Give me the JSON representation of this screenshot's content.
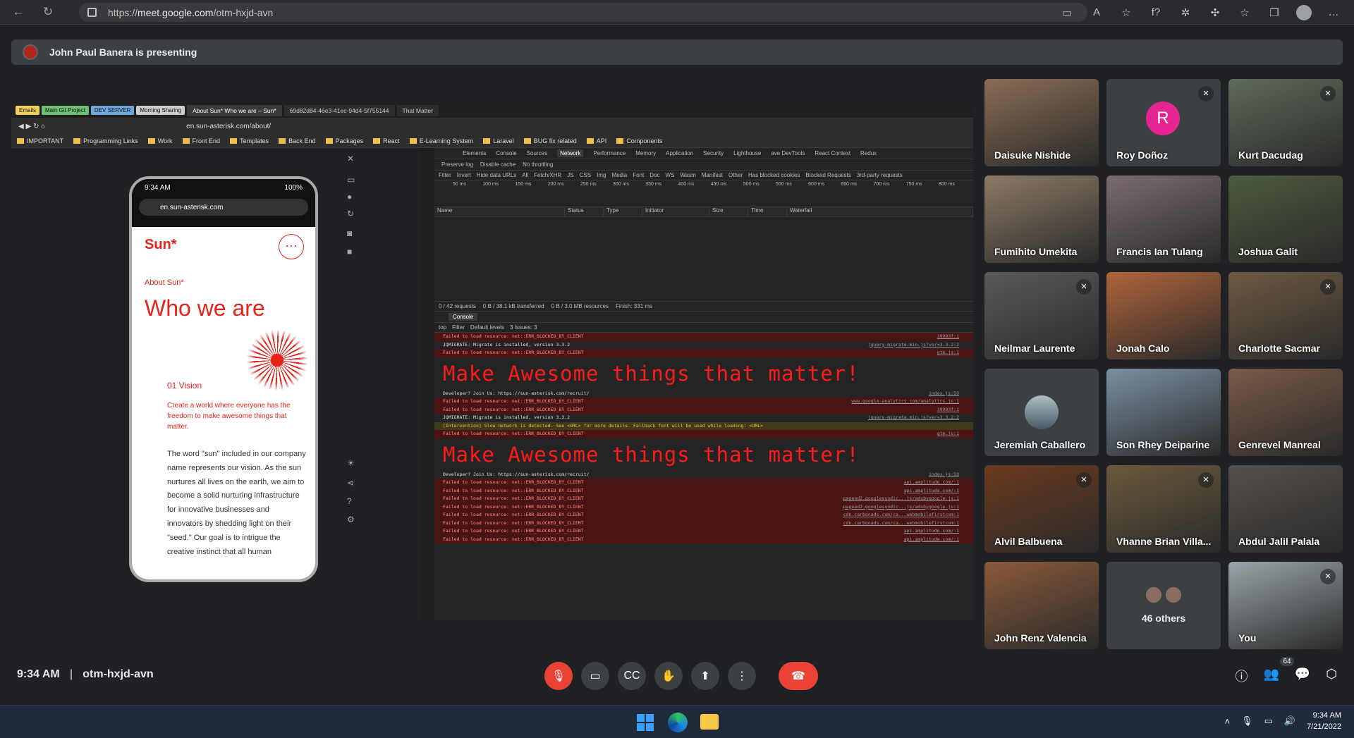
{
  "browser": {
    "url_prefix": "https://",
    "url_host": "meet.google.com",
    "url_path": "/otm-hxjd-avn",
    "profile_fn": "f?"
  },
  "presenter": {
    "text": "John Paul Banera is presenting"
  },
  "shared": {
    "bookmark_chips": [
      "Emails",
      "Main Git Project",
      "DEV SERVER",
      "Morning Sharing"
    ],
    "tabs": [
      "About Sun* Who we are – Sun*",
      "69d82d84-46e3-41ec-94d4-5f755144",
      "That Matter"
    ],
    "address": "en.sun-asterisk.com/about/",
    "bookmarks": [
      "IMPORTANT",
      "Programming Links",
      "Work",
      "Front End",
      "Templates",
      "Back End",
      "Packages",
      "React",
      "E-Learning System",
      "Laravel",
      "BUG fix related",
      "API",
      "Components"
    ],
    "phone": {
      "time": "9:34 AM",
      "battery": "100%",
      "url": "en.sun-asterisk.com",
      "logo": "Sun*",
      "menu": "···",
      "about": "About Sun*",
      "heading": "Who we are",
      "vision_label": "01  Vision",
      "vision_text": "Create a world where everyone has the freedom to make awesome things that matter.",
      "body": "The word \"sun\" included in our company name represents our vision. As the sun nurtures all lives on the earth, we aim to become a solid nurturing infrastructure for innovative businesses and innovators by shedding light on their \"seed.\" Our goal is to intrigue the creative instinct that all human"
    },
    "devtools": {
      "tabs": [
        "Elements",
        "Console",
        "Sources",
        "Network",
        "Performance",
        "Memory",
        "Application",
        "Security",
        "Lighthouse",
        "ave DevTools",
        "React Context",
        "Redux"
      ],
      "active_tab": "Network",
      "toolbar": [
        "Preserve log",
        "Disable cache",
        "No throttling"
      ],
      "filter": [
        "Filter",
        "Invert",
        "Hide data URLs",
        "All",
        "Fetch/XHR",
        "JS",
        "CSS",
        "Img",
        "Media",
        "Font",
        "Doc",
        "WS",
        "Wasm",
        "Manifest",
        "Other",
        "Has blocked cookies",
        "Blocked Requests",
        "3rd-party requests"
      ],
      "timeline": [
        "50 ms",
        "100 ms",
        "150 ms",
        "200 ms",
        "250 ms",
        "300 ms",
        "350 ms",
        "400 ms",
        "450 ms",
        "500 ms",
        "550 ms",
        "600 ms",
        "650 ms",
        "700 ms",
        "750 ms",
        "800 ms"
      ],
      "columns": [
        "Name",
        "Status",
        "Type",
        "Initiator",
        "Size",
        "Time",
        "Waterfall"
      ],
      "summary": [
        "0 / 42 requests",
        "0 B / 38.1 kB transferred",
        "0 B / 3.0 MB resources",
        "Finish: 331 ms"
      ],
      "console_tab": "Console",
      "console_filter": [
        "top",
        "Filter",
        "Default levels",
        "3 Issues: 3"
      ],
      "lines": [
        {
          "kind": "err",
          "text": "Failed to load resource: net::ERR_BLOCKED_BY_CLIENT",
          "src": "39993f:1"
        },
        {
          "kind": "info",
          "text": "JQMIGRATE: Migrate is installed, version 3.3.2",
          "src": "jquery-migrate.min.js?ver=3.3.2:2"
        },
        {
          "kind": "err",
          "text": "Failed to load resource: net::ERR_BLOCKED_BY_CLIENT",
          "src": "gtm.js:1"
        },
        {
          "kind": "banner",
          "text": "Make Awesome things that matter!",
          "src": "index.js:50"
        },
        {
          "kind": "info",
          "text": "Developer? Join Us: https://sun-asterisk.com/recruit/",
          "src": "index.js:50"
        },
        {
          "kind": "err",
          "text": "Failed to load resource: net::ERR_BLOCKED_BY_CLIENT",
          "src": "www.google-analytics.com/analytics.js:1"
        },
        {
          "kind": "err",
          "text": "Failed to load resource: net::ERR_BLOCKED_BY_CLIENT",
          "src": "39993f:1"
        },
        {
          "kind": "info",
          "text": "JQMIGRATE: Migrate is installed, version 3.3.2",
          "src": "jquery-migrate.min.js?ver=3.3.2:2"
        },
        {
          "kind": "warn",
          "text": "[Intervention] Slow network is detected. See <URL> for more details. Fallback font will be used while loading: <URL>",
          "src": ""
        },
        {
          "kind": "err",
          "text": "Failed to load resource: net::ERR_BLOCKED_BY_CLIENT",
          "src": "gtm.js:1"
        },
        {
          "kind": "banner",
          "text": "Make Awesome things that matter!",
          "src": "index.js:50"
        },
        {
          "kind": "info",
          "text": "Developer? Join Us: https://sun-asterisk.com/recruit/",
          "src": "index.js:50"
        },
        {
          "kind": "err",
          "text": "Failed to load resource: net::ERR_BLOCKED_BY_CLIENT",
          "src": "api.amplitude.com/:1"
        },
        {
          "kind": "err",
          "text": "Failed to load resource: net::ERR_BLOCKED_BY_CLIENT",
          "src": "api.amplitude.com/:1"
        },
        {
          "kind": "err",
          "text": "Failed to load resource: net::ERR_BLOCKED_BY_CLIENT",
          "src": "pagead2.googlesyndic...js/adsbygoogle.js:1"
        },
        {
          "kind": "err",
          "text": "Failed to load resource: net::ERR_BLOCKED_BY_CLIENT",
          "src": "pagead2.googlesyndic...js/adsbygoogle.js:1"
        },
        {
          "kind": "err",
          "text": "Failed to load resource: net::ERR_BLOCKED_BY_CLIENT",
          "src": "cdn.carbonads.com/ca...webmobilefirstcom:1"
        },
        {
          "kind": "err",
          "text": "Failed to load resource: net::ERR_BLOCKED_BY_CLIENT",
          "src": "cdn.carbonads.com/ca...webmobilefirstcom:1"
        },
        {
          "kind": "err",
          "text": "Failed to load resource: net::ERR_BLOCKED_BY_CLIENT",
          "src": "api.amplitude.com/:1"
        },
        {
          "kind": "err",
          "text": "Failed to load resource: net::ERR_BLOCKED_BY_CLIENT",
          "src": "api.amplitude.com/:1"
        }
      ]
    }
  },
  "participants": [
    {
      "name": "Daisuke Nishide",
      "muted": false,
      "bg": "#8a6d55"
    },
    {
      "name": "Roy Doñoz",
      "muted": true,
      "letter": "R"
    },
    {
      "name": "Kurt Dacudag",
      "muted": true,
      "bg": "#5f6a5a"
    },
    {
      "name": "Fumihito Umekita",
      "muted": false,
      "bg": "#8c7a66"
    },
    {
      "name": "Francis Ian Tulang",
      "muted": false,
      "bg": "#7a6c72"
    },
    {
      "name": "Joshua Galit",
      "muted": false,
      "bg": "#4d5a3f"
    },
    {
      "name": "Neilmar Laurente",
      "muted": true,
      "bg": "#5a5a5a"
    },
    {
      "name": "Jonah Calo",
      "muted": false,
      "bg": "#b0643a"
    },
    {
      "name": "Charlotte Sacmar",
      "muted": true,
      "bg": "#6e5a42"
    },
    {
      "name": "Jeremiah Caballero",
      "muted": false,
      "avatar": true
    },
    {
      "name": "Son Rhey Deiparine",
      "muted": false,
      "bg": "#7b8fa1"
    },
    {
      "name": "Genrevel Manreal",
      "muted": false,
      "bg": "#7a5a48"
    },
    {
      "name": "Alvil Balbuena",
      "muted": true,
      "bg": "#6b3a1e"
    },
    {
      "name": "Vhanne Brian Villa...",
      "muted": true,
      "bg": "#6b5a3c"
    },
    {
      "name": "Abdul Jalil Palala",
      "muted": false,
      "bg": "#55504b"
    },
    {
      "name": "John Renz Valencia",
      "muted": false,
      "bg": "#8a5a3a"
    },
    {
      "name": "46 others",
      "others": true
    },
    {
      "name": "You",
      "muted": true,
      "bg": "#9aa4a8"
    }
  ],
  "bottom": {
    "time": "9:34 AM",
    "code": "otm-hxjd-avn",
    "people_count": "64"
  },
  "taskbar": {
    "time": "9:34 AM",
    "date": "7/21/2022"
  }
}
